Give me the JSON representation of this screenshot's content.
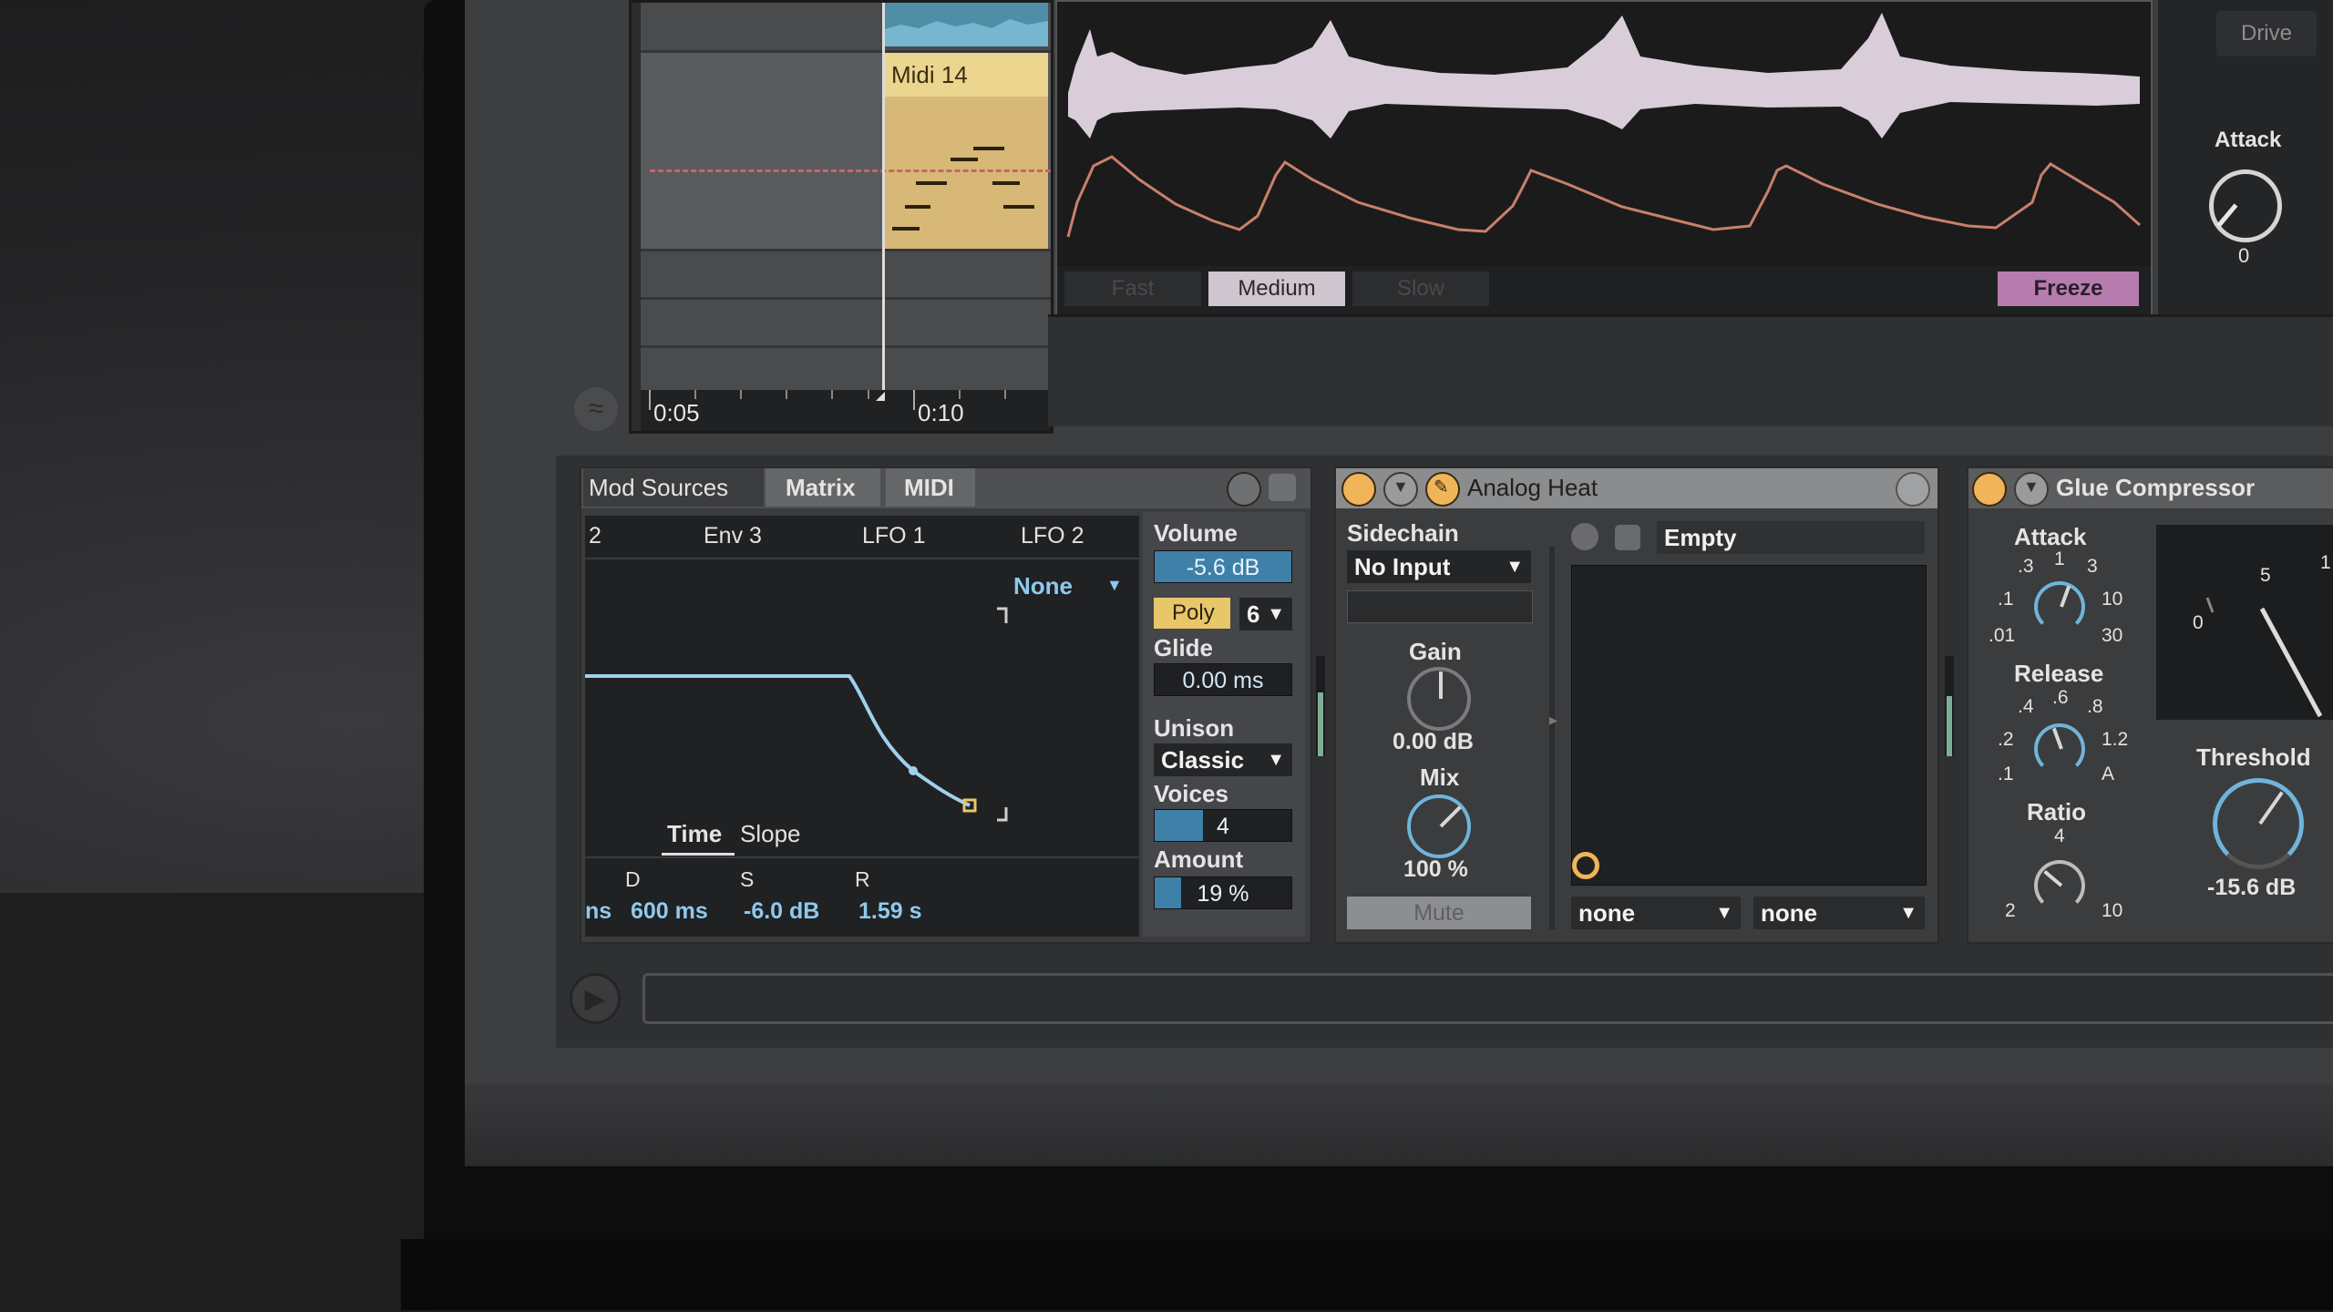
{
  "arrangement": {
    "clip_title": "Midi 14",
    "ruler": {
      "t1": "0:05",
      "t2": "0:10"
    }
  },
  "waveform": {
    "modes": [
      {
        "label": "Fast",
        "active": false
      },
      {
        "label": "Medium",
        "active": true
      },
      {
        "label": "Slow",
        "active": false
      }
    ],
    "freeze_label": "Freeze"
  },
  "drive_section": {
    "drive_label": "Drive",
    "attack_label": "Attack",
    "attack_value": "0"
  },
  "wavetable": {
    "tabs": [
      {
        "label": "Mod Sources",
        "active": true
      },
      {
        "label": "Matrix",
        "active": false
      },
      {
        "label": "MIDI",
        "active": false
      }
    ],
    "source_tabs": [
      "2",
      "Env 3",
      "LFO 1",
      "LFO 2"
    ],
    "target_select": "None",
    "time_label": "Time",
    "slope_label": "Slope",
    "adsr_labels": {
      "d": "D",
      "s": "S",
      "r": "R"
    },
    "adsr_values": {
      "prev": "ns",
      "d": "600 ms",
      "s": "-6.0 dB",
      "r": "1.59 s"
    },
    "volume_label": "Volume",
    "volume_value": "-5.6 dB",
    "poly_label": "Poly",
    "poly_voices": "6",
    "glide_label": "Glide",
    "glide_value": "0.00 ms",
    "unison_label": "Unison",
    "unison_mode": "Classic",
    "voices_label": "Voices",
    "voices_value": "4",
    "voices_fill": 0.35,
    "amount_label": "Amount",
    "amount_value": "19 %",
    "amount_fill": 0.19
  },
  "analog_heat": {
    "title": "Analog Heat",
    "sidechain_label": "Sidechain",
    "sidechain_value": "No Input",
    "gain_label": "Gain",
    "gain_value": "0.00 dB",
    "mix_label": "Mix",
    "mix_value": "100 %",
    "mute_label": "Mute",
    "preset_name": "Empty",
    "select_left": "none",
    "select_right": "none"
  },
  "glue": {
    "title": "Glue Compressor",
    "attack_label": "Attack",
    "attack_scale": [
      ".3",
      "1",
      "3",
      ".1",
      "10",
      ".01",
      "30"
    ],
    "release_label": "Release",
    "release_scale": [
      ".4",
      ".6",
      ".8",
      ".2",
      "1.2",
      ".1",
      "A"
    ],
    "ratio_label": "Ratio",
    "ratio_scale": [
      "4",
      "2",
      "10"
    ],
    "threshold_label": "Threshold",
    "threshold_value": "-15.6 dB",
    "meter_scale": [
      "0",
      "5",
      "1"
    ]
  },
  "colors": {
    "accent_blue": "#6fb4da",
    "poly_yellow": "#e8c66a",
    "device_on_orange": "#f0b45a",
    "freeze_purple": "#b77cae",
    "envelope_orange": "#c9806a"
  }
}
